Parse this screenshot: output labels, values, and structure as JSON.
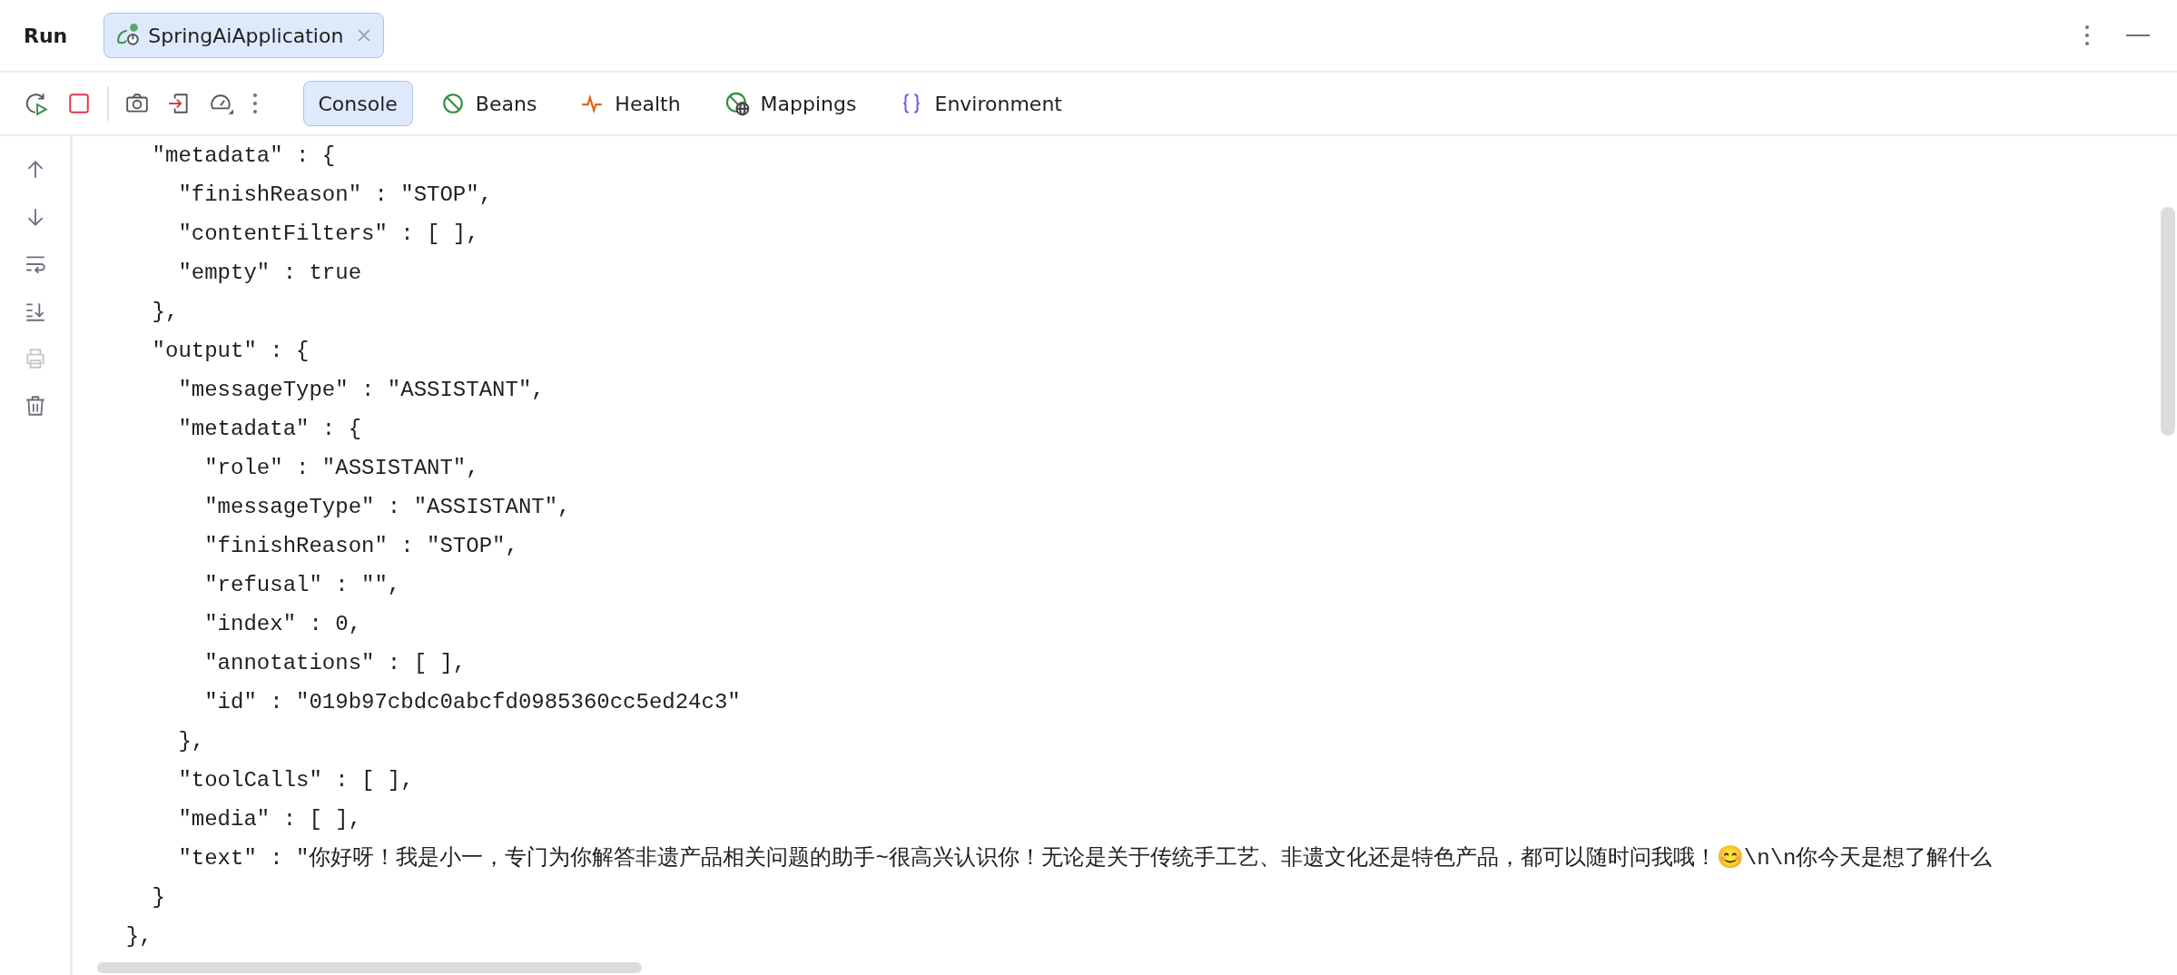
{
  "window": {
    "title": "Run"
  },
  "run_tab": {
    "label": "SpringAiApplication",
    "selected": true
  },
  "toolbar_tabs": [
    {
      "label": "Console",
      "selected": true,
      "kind": "console"
    },
    {
      "label": "Beans",
      "selected": false,
      "kind": "beans"
    },
    {
      "label": "Health",
      "selected": false,
      "kind": "health"
    },
    {
      "label": "Mappings",
      "selected": false,
      "kind": "mappings"
    },
    {
      "label": "Environment",
      "selected": false,
      "kind": "environment"
    }
  ],
  "gutter_buttons": [
    {
      "kind": "up",
      "disabled": false
    },
    {
      "kind": "down",
      "disabled": false
    },
    {
      "kind": "wrap",
      "disabled": false
    },
    {
      "kind": "scroll-end",
      "disabled": false
    },
    {
      "kind": "print",
      "disabled": true
    },
    {
      "kind": "clear",
      "disabled": false
    }
  ],
  "console": {
    "lines": [
      "    \"metadata\" : {",
      "      \"finishReason\" : \"STOP\",",
      "      \"contentFilters\" : [ ],",
      "      \"empty\" : true",
      "    },",
      "    \"output\" : {",
      "      \"messageType\" : \"ASSISTANT\",",
      "      \"metadata\" : {",
      "        \"role\" : \"ASSISTANT\",",
      "        \"messageType\" : \"ASSISTANT\",",
      "        \"finishReason\" : \"STOP\",",
      "        \"refusal\" : \"\",",
      "        \"index\" : 0,",
      "        \"annotations\" : [ ],",
      "        \"id\" : \"019b97cbdc0abcfd0985360cc5ed24c3\"",
      "      },",
      "      \"toolCalls\" : [ ],",
      "      \"media\" : [ ],",
      "      \"text\" : \"你好呀！我是小一，专门为你解答非遗产品相关问题的助手~很高兴认识你！无论是关于传统手工艺、非遗文化还是特色产品，都可以随时问我哦！😊\\n\\n你今天是想了解什么",
      "    }",
      "  },"
    ]
  }
}
